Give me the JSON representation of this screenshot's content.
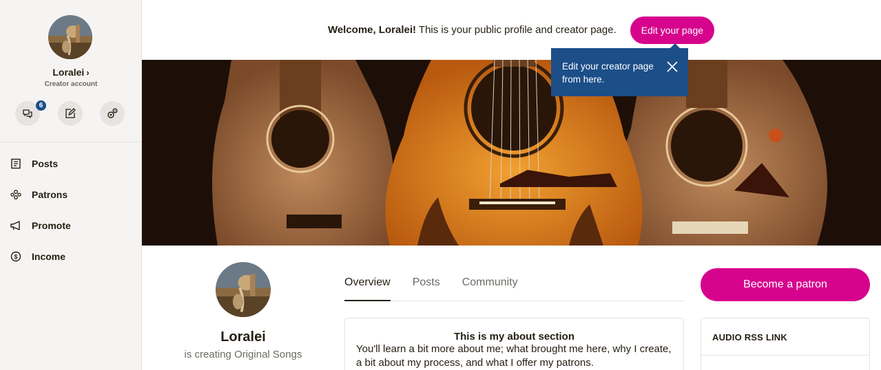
{
  "sidebar": {
    "user_name": "Loralei",
    "account_type": "Creator account",
    "messages_badge": "6",
    "nav": [
      {
        "label": "Posts",
        "icon": "posts-icon"
      },
      {
        "label": "Patrons",
        "icon": "patrons-icon"
      },
      {
        "label": "Promote",
        "icon": "megaphone-icon"
      },
      {
        "label": "Income",
        "icon": "dollar-icon"
      }
    ]
  },
  "header": {
    "welcome_bold": "Welcome, Loralei!",
    "welcome_rest": " This is your public profile and creator page.",
    "edit_button": "Edit your page"
  },
  "tooltip": {
    "text": "Edit your creator page from here."
  },
  "profile": {
    "name": "Loralei",
    "tagline": "is creating Original Songs",
    "tabs": [
      "Overview",
      "Posts",
      "Community"
    ],
    "active_tab": "Overview",
    "become_patron": "Become a patron"
  },
  "about": {
    "title": "This is my about section",
    "body": "You'll learn a bit more about me; what brought me here, why I create, a bit about my process, and what I offer my patrons."
  },
  "rss": {
    "title": "AUDIO RSS LINK"
  },
  "colors": {
    "accent": "#d6048d",
    "tooltip": "#1c4e88",
    "sidebar_bg": "#f5f4f2"
  }
}
